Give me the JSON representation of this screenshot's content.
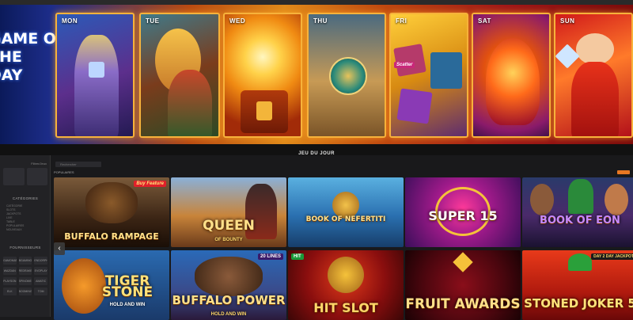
{
  "banner": {
    "game_of_the_day": [
      "GAME OF",
      "THE",
      "DAY"
    ],
    "days": [
      "MON",
      "TUE",
      "WED",
      "THU",
      "FRI",
      "SAT",
      "SUN"
    ],
    "fri_badge": "Scatter"
  },
  "bar": {
    "title": "JEU DU JOUR"
  },
  "sidebar": {
    "top_small": "Filtrer/Jeux",
    "categories_heading": "CATÉGORIES",
    "categories": [
      "CATÉGORIE",
      "SLOTS",
      "JACKPOTS",
      "LIVE",
      "TABLE",
      "POPULAIRES",
      "NOUVEAUX"
    ],
    "providers_heading": "FOURNISSEURS",
    "providers": [
      "GAMOMAT",
      "BGAMING",
      "ENDORPHINA",
      "WAZDAN",
      "REDRAKE",
      "EVOPLAY",
      "PLAYSON",
      "SPINOMENAL",
      "AMATIC",
      "ELK",
      "BOOMING",
      "TOM HORN"
    ]
  },
  "main": {
    "search_placeholder": "Rechercher",
    "section_title": "POPULAIRES",
    "arrow": "‹",
    "games": [
      {
        "title": "BUFFALO RAMPAGE",
        "badge": "Buy Feature"
      },
      {
        "title": "QUEEN",
        "sub": "OF BOUNTY"
      },
      {
        "title": "BOOK OF NEFERTITI"
      },
      {
        "title": "SUPER 15"
      },
      {
        "title": "BOOK OF EON"
      },
      {
        "title": "TIGER STONE",
        "sub": "HOLD AND WIN"
      },
      {
        "title": "BUFFALO POWER",
        "sub": "HOLD AND WIN",
        "badge": "20 LINES"
      },
      {
        "title": "HIT SLOT",
        "badge": "HIT"
      },
      {
        "title": "FRUIT AWARDS"
      },
      {
        "title": "STONED JOKER 5",
        "badge": "DAY 2 DAY JACKPOT"
      }
    ]
  }
}
